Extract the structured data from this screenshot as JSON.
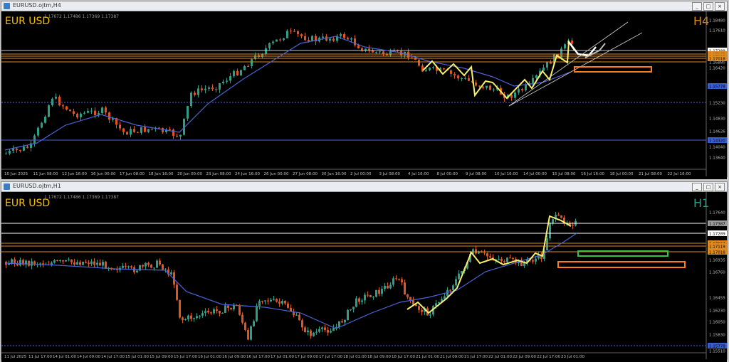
{
  "colors": {
    "bg": "#000000",
    "bull": "#2f9e86",
    "bear": "#e0551f",
    "ma": "#4a63d6",
    "zigzag": "#f7ef6a",
    "white": "#ffffff",
    "level_orange": "#e08a1e",
    "level_gray": "#c9c9c9",
    "box_orange": "#ff7a18",
    "box_green": "#35c24b",
    "axis_text": "#bfbfbf",
    "label_bg": "#3b5fcf",
    "symbol": "#f3c400"
  },
  "top": {
    "window_title": "EURUSD.ojtm,H4",
    "ohlc": "1.17672 1.17486 1.17369 1.17387",
    "symbol": "EUR USD",
    "timeframe": "H4",
    "buttons": {
      "min": "_",
      "max": "□",
      "close": "×"
    },
    "price_labels": [
      "1.18480",
      "1.17610",
      "1.17289",
      "1.17162",
      "1.17119",
      "1.17018",
      "1.16880",
      "1.16420",
      "1.15778",
      "1.15230",
      "1.14830",
      "1.14626",
      "1.14320",
      "1.14040",
      "1.13640"
    ],
    "time_labels": [
      "10 Jun 2025",
      "11 Jun 08:00",
      "12 Jun 16:00",
      "16 Jun 00:00",
      "17 Jun 08:00",
      "18 Jun 16:00",
      "20 Jun 00:00",
      "23 Jun 08:00",
      "24 Jun 16:00",
      "26 Jun 00:00",
      "27 Jun 08:00",
      "30 Jun 16:00",
      "2 Jul 00:00",
      "3 Jul 08:00",
      "4 Jul 16:00",
      "8 Jul 00:00",
      "9 Jul 08:00",
      "10 Jul 16:00",
      "14 Jul 00:00",
      "15 Jul 08:00",
      "16 Jul 16:00",
      "18 Jul 00:00",
      "21 Jul 08:00",
      "22 Jul 16:00"
    ]
  },
  "bottom": {
    "window_title": "EURUSD.ojtm,H1",
    "ohlc": "1.17672 1.17486 1.17369 1.17387",
    "symbol": "EUR USD",
    "timeframe": "H1",
    "buttons": {
      "min": "_",
      "max": "□",
      "close": "×"
    },
    "price_labels": [
      "1.17640",
      "1.17387",
      "1.17289",
      "1.17162",
      "1.17119",
      "1.17018",
      "1.16935",
      "1.16760",
      "1.16455",
      "1.16230",
      "1.16050",
      "1.15830",
      "1.15778",
      "1.15510"
    ],
    "time_labels": [
      "11 Jul 2025",
      "11 Jul 17:00",
      "14 Jul 01:00",
      "14 Jul 09:00",
      "14 Jul 17:00",
      "15 Jul 01:00",
      "15 Jul 09:00",
      "15 Jul 17:00",
      "16 Jul 01:00",
      "16 Jul 09:00",
      "16 Jul 17:00",
      "17 Jul 01:00",
      "17 Jul 09:00",
      "17 Jul 17:00",
      "18 Jul 01:00",
      "18 Jul 09:00",
      "18 Jul 17:00",
      "21 Jul 01:00",
      "21 Jul 09:00",
      "21 Jul 17:00",
      "22 Jul 01:00",
      "22 Jul 09:00",
      "22 Jul 17:00",
      "23 Jul 01:00"
    ]
  }
}
